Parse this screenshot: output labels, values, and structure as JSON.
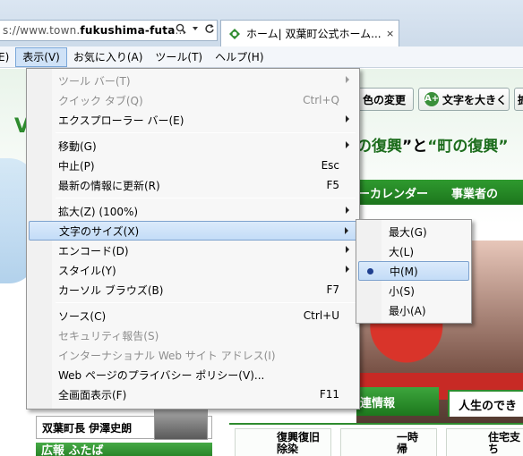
{
  "browser": {
    "address_prefix": "s://www.town.",
    "address_domain": "fukushima-futa",
    "address_suffix": "...",
    "tab_label": "ホーム| 双葉町公式ホーム...",
    "tab_close": "×"
  },
  "menubar": {
    "items": [
      {
        "label": "E)"
      },
      {
        "label": "表示(V)"
      },
      {
        "label": "お気に入り(A)"
      },
      {
        "label": "ツール(T)"
      },
      {
        "label": "ヘルプ(H)"
      }
    ]
  },
  "view_menu": {
    "items": [
      {
        "label": "ツール バー(T)",
        "shortcut": "",
        "submenu": true,
        "disabled": true
      },
      {
        "label": "クイック タブ(Q)",
        "shortcut": "Ctrl+Q",
        "submenu": false,
        "disabled": true
      },
      {
        "label": "エクスプローラー バー(E)",
        "shortcut": "",
        "submenu": true,
        "disabled": false
      },
      {
        "label": "移動(G)",
        "shortcut": "",
        "submenu": true,
        "disabled": false
      },
      {
        "label": "中止(P)",
        "shortcut": "Esc",
        "submenu": false,
        "disabled": false
      },
      {
        "label": "最新の情報に更新(R)",
        "shortcut": "F5",
        "submenu": false,
        "disabled": false
      },
      {
        "label": "拡大(Z) (100%)",
        "shortcut": "",
        "submenu": true,
        "disabled": false
      },
      {
        "label": "文字のサイズ(X)",
        "shortcut": "",
        "submenu": true,
        "disabled": false
      },
      {
        "label": "エンコード(D)",
        "shortcut": "",
        "submenu": true,
        "disabled": false
      },
      {
        "label": "スタイル(Y)",
        "shortcut": "",
        "submenu": true,
        "disabled": false
      },
      {
        "label": "カーソル ブラウズ(B)",
        "shortcut": "F7",
        "submenu": false,
        "disabled": false
      },
      {
        "label": "ソース(C)",
        "shortcut": "Ctrl+U",
        "submenu": false,
        "disabled": false
      },
      {
        "label": "セキュリティ報告(S)",
        "shortcut": "",
        "submenu": false,
        "disabled": true
      },
      {
        "label": "インターナショナル Web サイト アドレス(I)",
        "shortcut": "",
        "submenu": false,
        "disabled": true
      },
      {
        "label": "Web ページのプライバシー ポリシー(V)...",
        "shortcut": "",
        "submenu": false,
        "disabled": false
      },
      {
        "label": "全画面表示(F)",
        "shortcut": "F11",
        "submenu": false,
        "disabled": false
      }
    ]
  },
  "text_size_menu": {
    "items": [
      {
        "label": "最大(G)"
      },
      {
        "label": "大(L)"
      },
      {
        "label": "中(M)"
      },
      {
        "label": "小(S)"
      },
      {
        "label": "最小(A)"
      }
    ]
  },
  "page": {
    "color_change_label": "色の変更",
    "bigger_text_label": "文字を大きく",
    "bigger_text_icon": "A+",
    "extra_label": "拡",
    "slogan_part1": "の復興",
    "slogan_part2": "と",
    "slogan_part3": "“町の復興”",
    "nav_calendar": "ーカレンダー",
    "nav_business": "事業者の",
    "tab_related": "連情報",
    "tab_life": "人生のでき",
    "card_recovery": "復興復旧",
    "card_recovery_sub": "除染",
    "card_return": "一時",
    "card_return_sub": "帰",
    "card_housing": "住宅支",
    "card_housing_sub": "ち",
    "mayor_label": "双葉町長 伊澤史朗",
    "futaba_label": "広報 ふたば",
    "left_letter": "V"
  },
  "colors": {
    "accent_green": "#2e8b2e",
    "menu_highlight": "#c3dcf7",
    "radio_dot": "#1f3f8f"
  }
}
